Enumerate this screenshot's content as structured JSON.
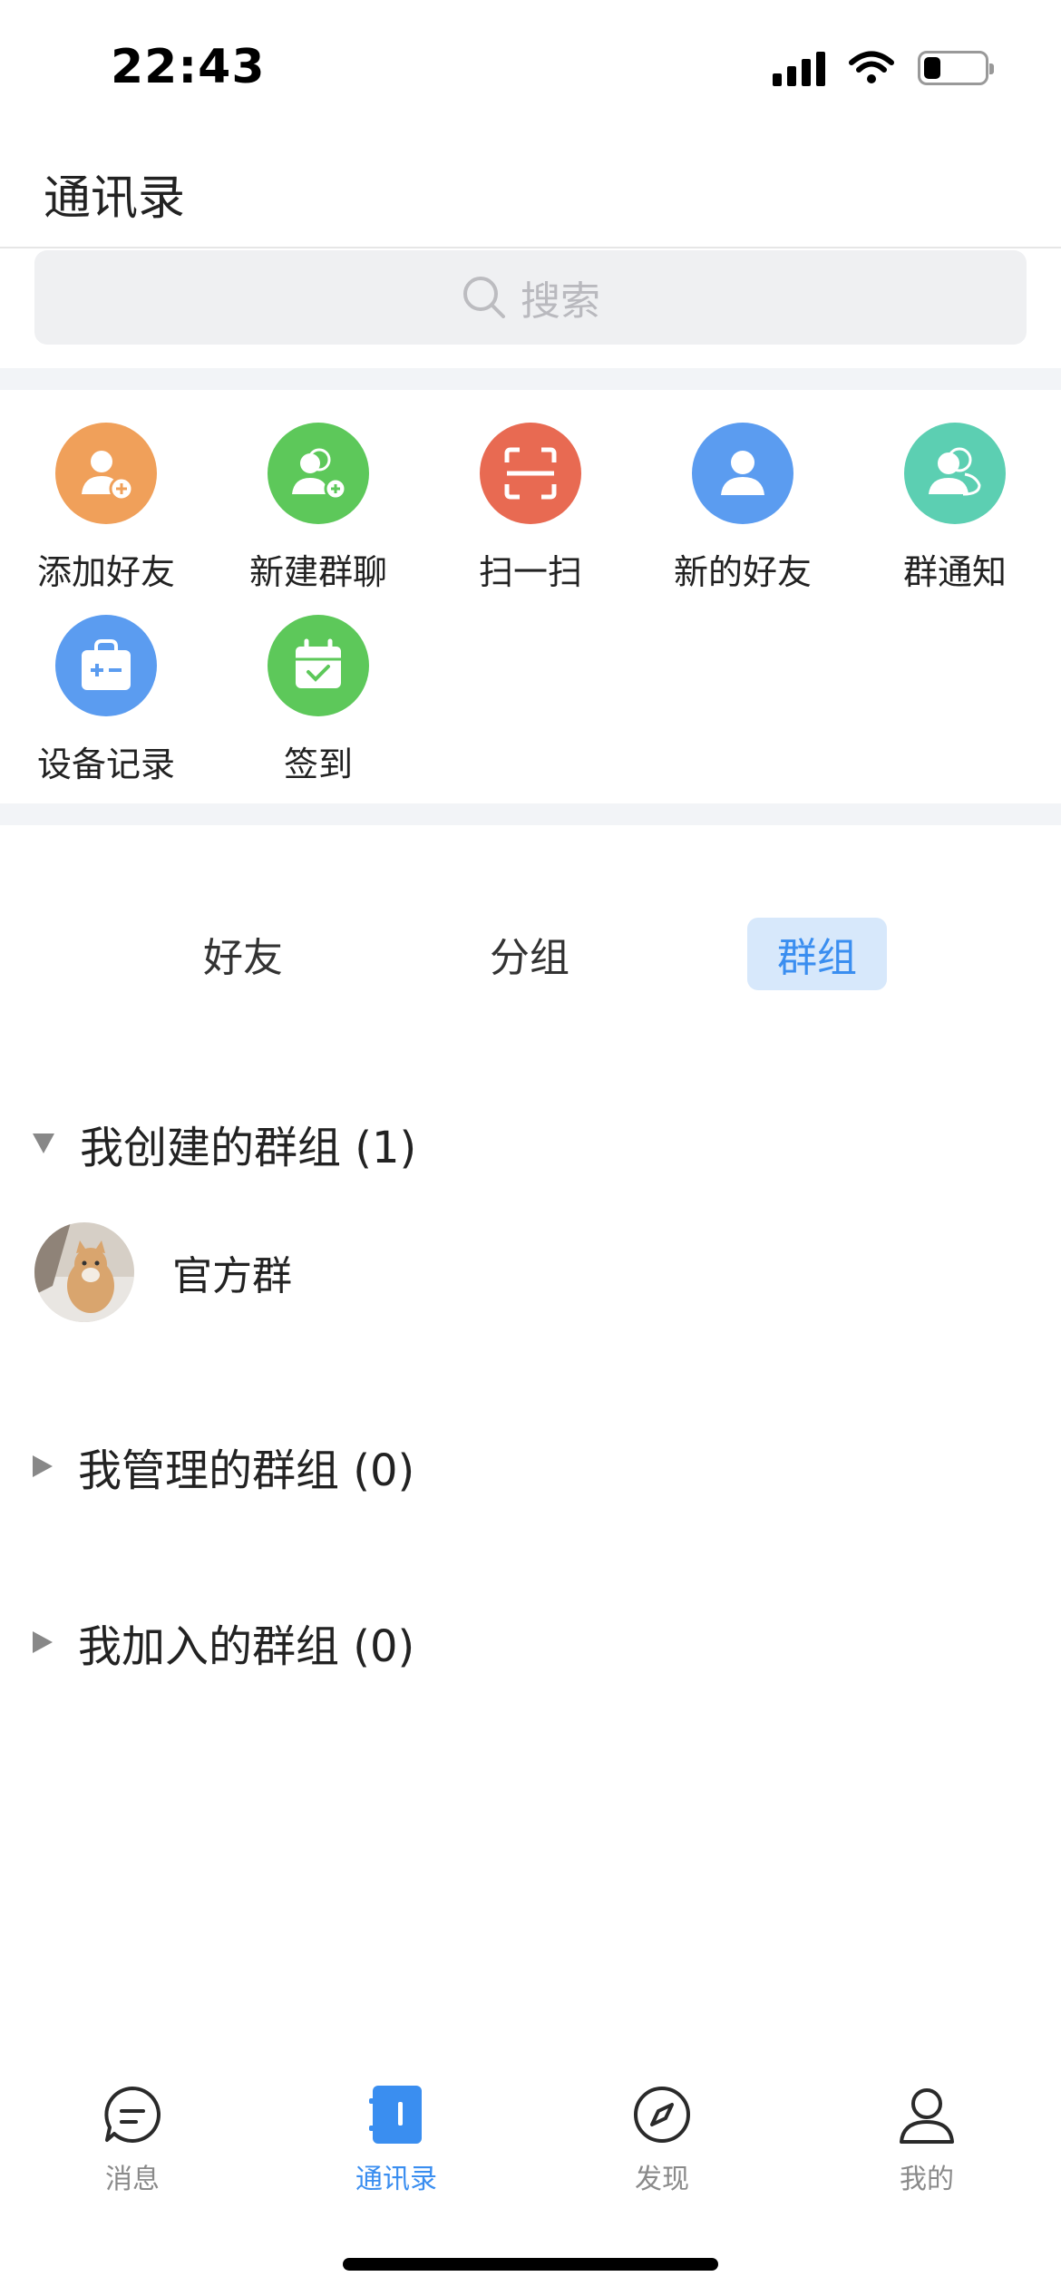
{
  "status_bar": {
    "time": "22:43",
    "battery_level": 0.28
  },
  "header": {
    "title": "通讯录"
  },
  "search": {
    "placeholder": "搜索"
  },
  "quick_actions": [
    {
      "label": "添加好友",
      "icon": "add-friend-icon",
      "color": "#f0a05a"
    },
    {
      "label": "新建群聊",
      "icon": "new-group-chat-icon",
      "color": "#5dc85a"
    },
    {
      "label": "扫一扫",
      "icon": "scan-icon",
      "color": "#e86a52"
    },
    {
      "label": "新的好友",
      "icon": "new-friend-icon",
      "color": "#5b9cf0"
    },
    {
      "label": "群通知",
      "icon": "group-notice-icon",
      "color": "#5ccfb2"
    },
    {
      "label": "设备记录",
      "icon": "device-record-icon",
      "color": "#5b9cf0"
    },
    {
      "label": "签到",
      "icon": "check-in-icon",
      "color": "#5dc85a"
    }
  ],
  "tabs": [
    {
      "label": "好友",
      "active": false
    },
    {
      "label": "分组",
      "active": false
    },
    {
      "label": "群组",
      "active": true
    }
  ],
  "groups": {
    "created": {
      "label": "我创建的群组 (1)",
      "expanded": true,
      "items": [
        {
          "name": "官方群"
        }
      ]
    },
    "managed": {
      "label": "我管理的群组 (0)",
      "expanded": false
    },
    "joined": {
      "label": "我加入的群组 (0)",
      "expanded": false
    }
  },
  "bottom_nav": [
    {
      "label": "消息",
      "icon": "message-icon",
      "active": false
    },
    {
      "label": "通讯录",
      "icon": "contacts-icon",
      "active": true
    },
    {
      "label": "发现",
      "icon": "compass-icon",
      "active": false
    },
    {
      "label": "我的",
      "icon": "profile-icon",
      "active": false
    }
  ],
  "colors": {
    "accent": "#3a8ef0",
    "tab_active_bg": "#d7e8fb"
  }
}
